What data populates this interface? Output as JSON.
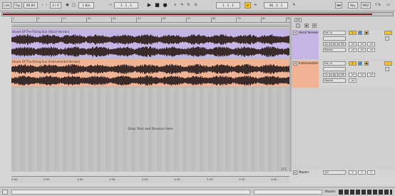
{
  "control_bar": {
    "link": "Link",
    "tap": "Tap",
    "tempo": "80.00",
    "bar_grid": "1 Bar",
    "time_sig": "4 / 4",
    "position_a": "1 .  1 .  1",
    "position_b": "1 .  1 .  1",
    "loop_length": "46 .  2 .  1",
    "key": "Key",
    "midi": "MIDI",
    "cpu": "7 %"
  },
  "ruler": {
    "bars": [
      "1",
      "9",
      "17",
      "25",
      "33",
      "41",
      "49",
      "57",
      "65",
      "73",
      "81",
      "89"
    ]
  },
  "clips": [
    {
      "title": "House Of The Rising Sun (Vocal Version)"
    },
    {
      "title": "House Of The Rising Sun (Instrumental Version)"
    }
  ],
  "arrangement": {
    "drop_text": "Drop Files and Devices Here"
  },
  "mixer": {
    "set_label": "Set",
    "tracks": [
      {
        "name": "Vocal Version",
        "input": "Ext. In",
        "channel": "1",
        "monitor": "Master",
        "number": "1",
        "sends": [
          "-inf",
          "-inf",
          "-inf"
        ],
        "color": "#c5b4e6"
      },
      {
        "name": "Instrumental V",
        "input": "Ext. In",
        "channel": "2",
        "monitor": "Master",
        "number": "2",
        "sends": [
          "-inf",
          "-inf",
          "-inf"
        ],
        "color": "#f0b494"
      }
    ],
    "master": {
      "name": "Master",
      "output": "1/2",
      "value": "0"
    },
    "page_counter": "2/1"
  },
  "timeline": {
    "times": [
      "0:00",
      "0:30",
      "1:00",
      "1:30",
      "2:00",
      "2:30",
      "3:00",
      "3:30",
      "4:00"
    ]
  },
  "status": {
    "master_label": "Master"
  },
  "colors": {
    "vocal": "#c5b4e6",
    "instrumental": "#f0b494",
    "accent": "#f3c12b",
    "overview_fill": "#7a1c22"
  }
}
